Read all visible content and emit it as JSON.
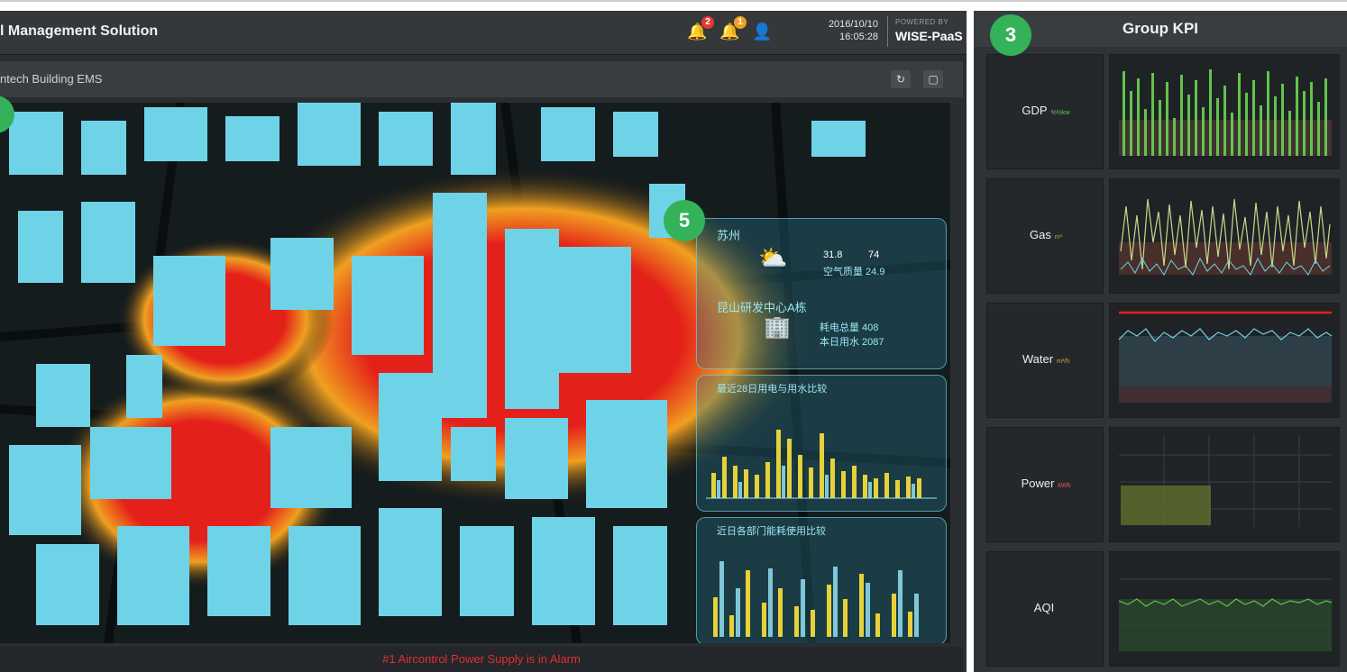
{
  "app": {
    "title": "l Management Solution",
    "datetime_date": "2016/10/10",
    "datetime_time": "16:05:28",
    "powered_label": "POWERED BY",
    "powered_brand": "WISE-PaaS",
    "alarm_badge_1": "2",
    "alarm_badge_2": "1"
  },
  "subheader": {
    "title": "ntech Building EMS"
  },
  "alarm": {
    "message": "#1 Aircontrol Power Supply is in Alarm"
  },
  "markers": {
    "m3": "3",
    "m5": "5"
  },
  "overlay": {
    "weather_city": "苏州",
    "weather_temp": "31.8",
    "weather_humidity": "74",
    "weather_pm": "空气质量 24.9",
    "building_name": "昆山研发中心A栋",
    "building_power": "耗电总量 408",
    "building_water": "本日用水 2087",
    "chart1_title": "最近28日用电与用水比较",
    "chart2_title": "近日各部门能耗使用比较"
  },
  "kpi": {
    "title": "Group KPI",
    "rows": [
      {
        "label": "GDP",
        "unit": "%%kw",
        "color": "#62c44b"
      },
      {
        "label": "Gas",
        "unit": "m³",
        "color": "#c7d98b"
      },
      {
        "label": "Water",
        "unit": "m³/h",
        "color": "#e4a33c"
      },
      {
        "label": "Power",
        "unit": "kWh",
        "color": "#e05b4b"
      },
      {
        "label": "AQI",
        "unit": "",
        "color": "#4fbf4f"
      }
    ]
  },
  "colors": {
    "accent_green": "#33b25a",
    "building_cyan": "#6fd3e8",
    "heat_red": "#e4201a",
    "alarm_red": "#e0322c"
  }
}
